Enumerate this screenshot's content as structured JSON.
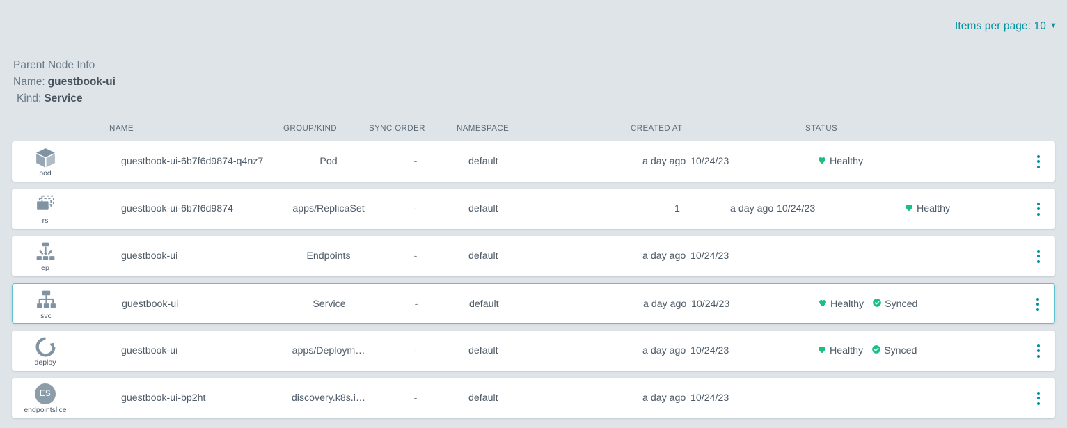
{
  "toolbar": {
    "items_per_page_label": "Items per page: 10",
    "items_per_page_value": "10",
    "caret_icon": "chevron-down-icon",
    "accent_color": "#00929e"
  },
  "parent_node_info": {
    "title": "Parent Node Info",
    "name_label": "Name:",
    "name_value": "guestbook-ui",
    "kind_label": "Kind:",
    "kind_value": "Service"
  },
  "table": {
    "headers": {
      "name": "NAME",
      "group_kind": "GROUP/KIND",
      "sync_order": "SYNC ORDER",
      "namespace": "NAMESPACE",
      "created_at": "CREATED AT",
      "status": "STATUS"
    },
    "colors": {
      "icon_gray": "#7f93a3",
      "healthy_green": "#1bbf84",
      "synced_green": "#1bbf84",
      "selected_border": "#5fc3cd",
      "row_background": "#ffffff",
      "page_background": "#dfe4e9"
    },
    "rows": [
      {
        "icon": "pod-icon",
        "icon_label": "pod",
        "name": "guestbook-ui-6b7f6d9874-q4nz7",
        "group_kind": "Pod",
        "sync_order": "-",
        "namespace": "default",
        "revision": "",
        "created_ago": "a day ago",
        "created_date": "10/24/23",
        "statuses": [
          {
            "icon": "heart-icon",
            "label": "Healthy",
            "color": "#1bbf84"
          }
        ],
        "selected": false,
        "shifted": false
      },
      {
        "icon": "replicaset-icon",
        "icon_label": "rs",
        "name": "guestbook-ui-6b7f6d9874",
        "group_kind": "apps/ReplicaSet",
        "sync_order": "-",
        "namespace": "default",
        "revision": "1",
        "created_ago": "a day ago",
        "created_date": "10/24/23",
        "statuses": [
          {
            "icon": "heart-icon",
            "label": "Healthy",
            "color": "#1bbf84"
          }
        ],
        "selected": false,
        "shifted": true
      },
      {
        "icon": "endpoints-icon",
        "icon_label": "ep",
        "name": "guestbook-ui",
        "group_kind": "Endpoints",
        "sync_order": "-",
        "namespace": "default",
        "revision": "",
        "created_ago": "a day ago",
        "created_date": "10/24/23",
        "statuses": [],
        "selected": false,
        "shifted": false
      },
      {
        "icon": "service-icon",
        "icon_label": "svc",
        "name": "guestbook-ui",
        "group_kind": "Service",
        "sync_order": "-",
        "namespace": "default",
        "revision": "",
        "created_ago": "a day ago",
        "created_date": "10/24/23",
        "statuses": [
          {
            "icon": "heart-icon",
            "label": "Healthy",
            "color": "#1bbf84"
          },
          {
            "icon": "check-circle-icon",
            "label": "Synced",
            "color": "#1bbf84"
          }
        ],
        "selected": true,
        "shifted": false
      },
      {
        "icon": "deployment-icon",
        "icon_label": "deploy",
        "name": "guestbook-ui",
        "group_kind": "apps/Deploym…",
        "sync_order": "-",
        "namespace": "default",
        "revision": "",
        "created_ago": "a day ago",
        "created_date": "10/24/23",
        "statuses": [
          {
            "icon": "heart-icon",
            "label": "Healthy",
            "color": "#1bbf84"
          },
          {
            "icon": "check-circle-icon",
            "label": "Synced",
            "color": "#1bbf84"
          }
        ],
        "selected": false,
        "shifted": false
      },
      {
        "icon": "endpointslice-icon",
        "icon_label": "endpointslice",
        "icon_text": "ES",
        "name": "guestbook-ui-bp2ht",
        "group_kind": "discovery.k8s.i…",
        "sync_order": "-",
        "namespace": "default",
        "revision": "",
        "created_ago": "a day ago",
        "created_date": "10/24/23",
        "statuses": [],
        "selected": false,
        "shifted": false
      }
    ],
    "row_menu_icon": "kebab-menu-icon"
  }
}
